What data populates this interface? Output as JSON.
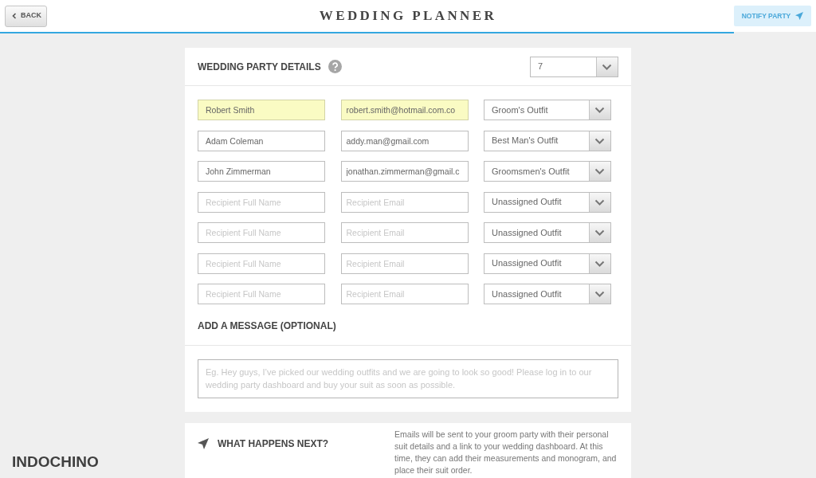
{
  "header": {
    "back_button": {
      "label": "BACK"
    },
    "title": "WEDDING PLANNER",
    "notify_button": {
      "label": "NOTIFY PARTY",
      "disabled": true
    }
  },
  "party_details": {
    "title": "WEDDING PARTY DETAILS",
    "party_size": "7",
    "recipients": [
      {
        "name": {
          "value": "Robert Smith"
        },
        "email": {
          "value": "robert.smith@hotmail.com.co"
        },
        "outfit": "Groom's Outfit",
        "autofilled": true
      },
      {
        "name": {
          "value": "Adam Coleman"
        },
        "email": {
          "value": "addy.man@gmail.com"
        },
        "outfit": "Best Man's Outfit",
        "autofilled": false
      },
      {
        "name": {
          "value": "John Zimmerman"
        },
        "email": {
          "value": "jonathan.zimmerman@gmail.c"
        },
        "outfit": "Groomsmen's Outfit",
        "autofilled": false
      },
      {
        "name": {
          "placeholder": "Recipient Full Name"
        },
        "email": {
          "placeholder": "Recipient Email"
        },
        "outfit": "Unassigned Outfit",
        "autofilled": false
      },
      {
        "name": {
          "placeholder": "Recipient Full Name"
        },
        "email": {
          "placeholder": "Recipient Email"
        },
        "outfit": "Unassigned Outfit",
        "autofilled": false
      },
      {
        "name": {
          "placeholder": "Recipient Full Name"
        },
        "email": {
          "placeholder": "Recipient Email"
        },
        "outfit": "Unassigned Outfit",
        "autofilled": false
      },
      {
        "name": {
          "placeholder": "Recipient Full Name"
        },
        "email": {
          "placeholder": "Recipient Email"
        },
        "outfit": "Unassigned Outfit",
        "autofilled": false
      }
    ]
  },
  "message": {
    "title": "ADD A MESSAGE (OPTIONAL)",
    "placeholder": "Eg. Hey guys, I’ve picked our wedding outfits and we are going to look so good! Please log in to our wedding party dashboard and buy your suit as soon as possible."
  },
  "next_steps": {
    "title": "WHAT HAPPENS NEXT?",
    "text": "Emails will be sent to your groom party with their personal suit details and a link to your wedding dashboard. At this time, they can add their measurements and monogram, and place their suit order."
  },
  "brand": {
    "logo": "INDOCHINO"
  }
}
